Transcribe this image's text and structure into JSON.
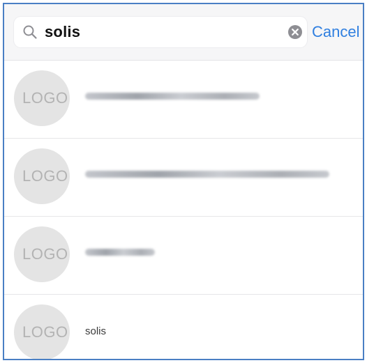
{
  "search": {
    "query": "solis",
    "cancel_label": "Cancel"
  },
  "results": [
    {
      "logo_text": "LOGO",
      "name": ""
    },
    {
      "logo_text": "LOGO",
      "name": ""
    },
    {
      "logo_text": "LOGO",
      "name": ""
    },
    {
      "logo_text": "LOGO",
      "name": "solis"
    }
  ],
  "colors": {
    "accent": "#2f7fe0",
    "frame_border": "#4a7fc4",
    "avatar": "#e4e4e4"
  },
  "icons": {
    "search": "search-icon",
    "clear": "clear-icon"
  }
}
